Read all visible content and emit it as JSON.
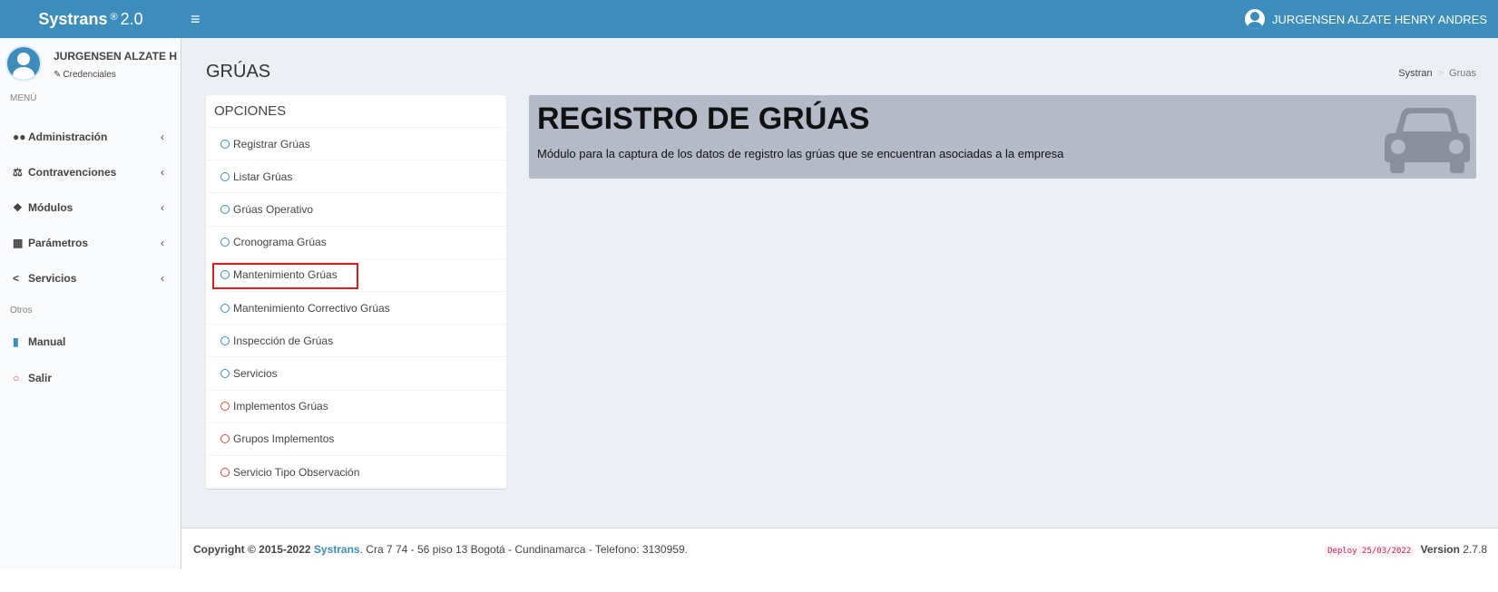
{
  "app": {
    "brand": "Systrans",
    "reg": "®",
    "version_label": "2.0"
  },
  "header": {
    "user_name": "JURGENSEN ALZATE HENRY ANDRES"
  },
  "sidebar": {
    "user_name": "JURGENSEN ALZATE H",
    "credentials_label": "Credenciales",
    "menu_header": "MENÚ",
    "others_header": "Otros",
    "items": [
      {
        "label": "Administración",
        "icon": "users-icon"
      },
      {
        "label": "Contravenciones",
        "icon": "balance-scale-icon"
      },
      {
        "label": "Módulos",
        "icon": "cubes-icon"
      },
      {
        "label": "Parámetros",
        "icon": "sitemap-icon"
      },
      {
        "label": "Servicios",
        "icon": "share-icon"
      }
    ],
    "other_items": [
      {
        "label": "Manual",
        "icon": "book-icon"
      },
      {
        "label": "Salir",
        "icon": "circle-icon"
      }
    ]
  },
  "page": {
    "title": "GRÚAS",
    "breadcrumb": {
      "root": "Systran",
      "current": "Gruas"
    }
  },
  "options": {
    "title": "OPCIONES",
    "items": [
      {
        "label": "Registrar Grúas",
        "color": "blue"
      },
      {
        "label": "Listar Grúas",
        "color": "blue"
      },
      {
        "label": "Grúas Operativo",
        "color": "blue"
      },
      {
        "label": "Cronograma Grúas",
        "color": "blue"
      },
      {
        "label": "Mantenimiento Grúas",
        "color": "blue",
        "highlighted": true
      },
      {
        "label": "Mantenimiento Correctivo Grúas",
        "color": "blue"
      },
      {
        "label": "Inspección de Grúas",
        "color": "blue"
      },
      {
        "label": "Servicios",
        "color": "blue"
      },
      {
        "label": "Implementos Grúas",
        "color": "red"
      },
      {
        "label": "Grupos Implementos",
        "color": "red"
      },
      {
        "label": "Servicio Tipo Observación",
        "color": "red"
      }
    ]
  },
  "banner": {
    "title": "REGISTRO DE GRÚAS",
    "description": "Módulo para la captura de los datos de registro las grúas que se encuentran asociadas a la empresa",
    "icon": "car-icon"
  },
  "footer": {
    "copyright_prefix": "Copyright © 2015-2022",
    "brand": "Systrans",
    "address": ". Cra 7 74 - 56 piso 13 Bogotá - Cundinamarca - Telefono: 3130959.",
    "deploy": "Deploy 25/03/2022",
    "version_label": "Version",
    "version": "2.7.8"
  },
  "colors": {
    "header": "#3c8dbc",
    "content_bg": "#ecf0f5",
    "banner": "#b5bac8",
    "highlight": "#e31b1b"
  }
}
